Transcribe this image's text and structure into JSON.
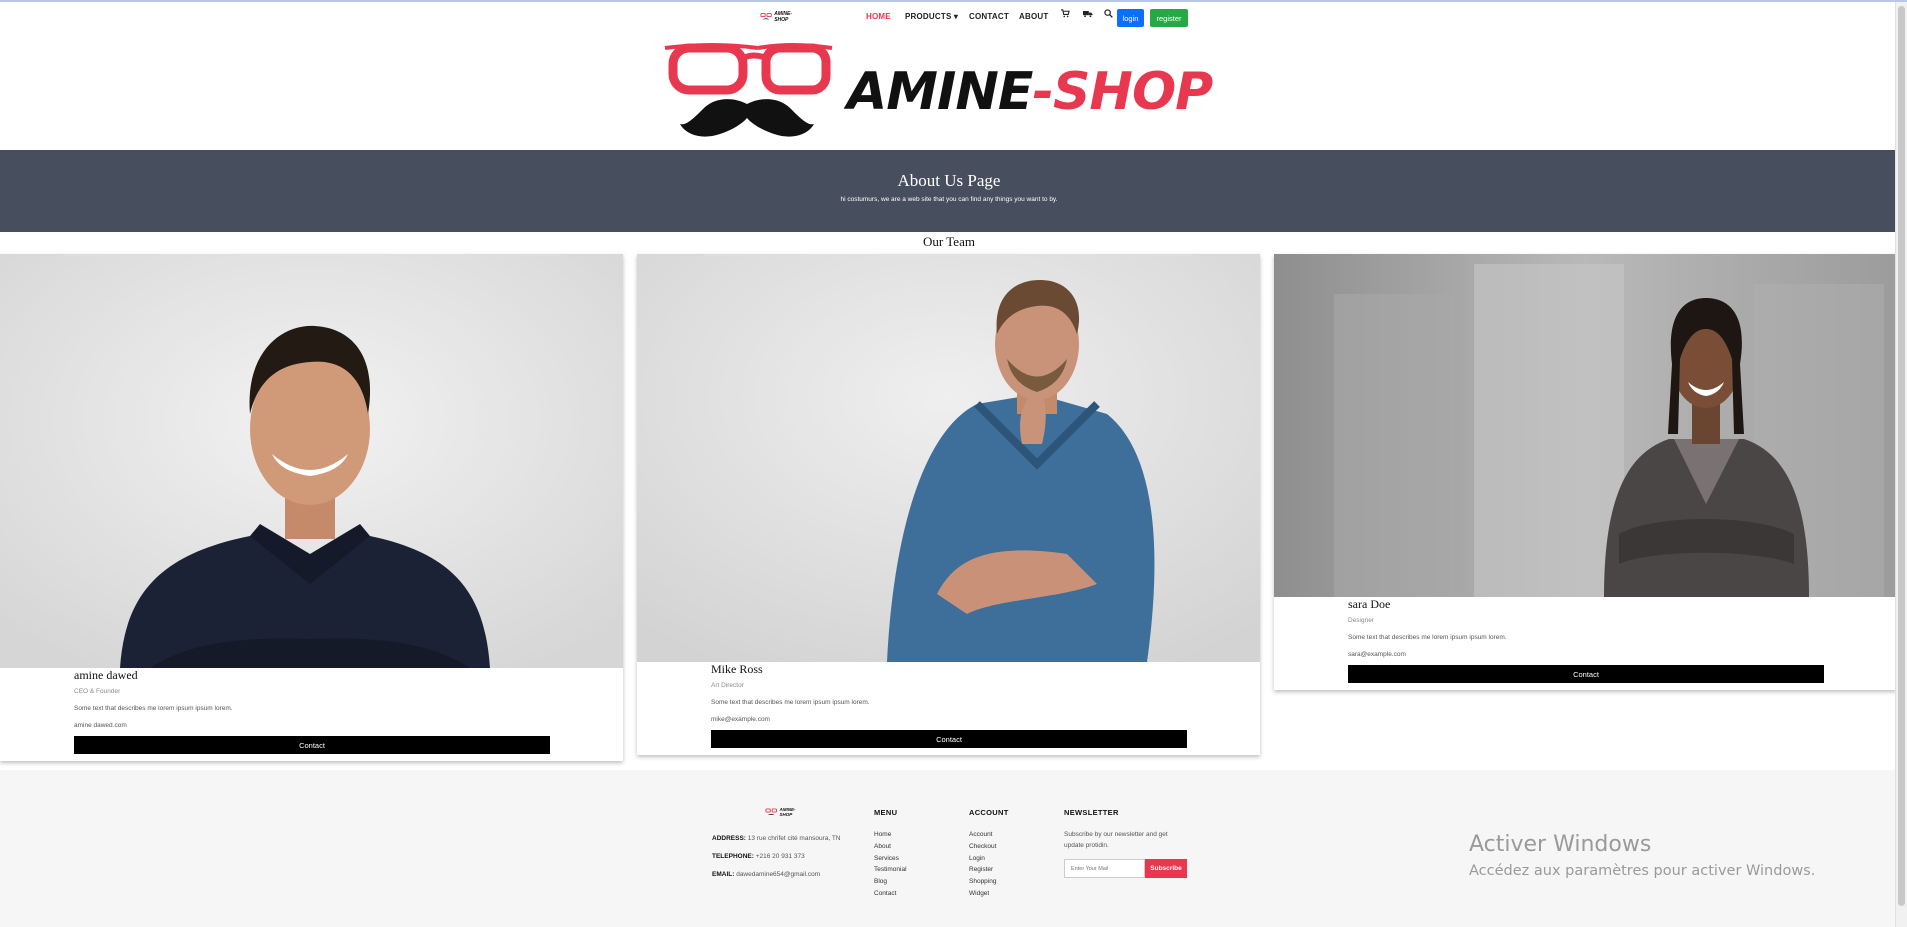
{
  "nav": {
    "logo_text": "AMINE-SHOP",
    "links": [
      {
        "label": "HOME"
      },
      {
        "label": "PRODUCTS ▾"
      },
      {
        "label": "CONTACT"
      },
      {
        "label": "ABOUT"
      }
    ],
    "icons": [
      "cart-icon",
      "delivery-truck-icon",
      "search-icon"
    ],
    "login_label": "login",
    "register_label": "register",
    "active_color": "#e8384f"
  },
  "hero": {
    "brand_part1": "AMINE",
    "brand_part2": "-SHOP",
    "brand_accent": "#e8384f"
  },
  "banner": {
    "title": "About Us Page",
    "subtitle": "hi costumurs, we are a web site that you can find any things you want to by."
  },
  "team": {
    "heading": "Our Team",
    "members": [
      {
        "name": "amine dawed",
        "role": "CEO & Founder",
        "description": "Some text that describes me lorem ipsum ipsum lorem.",
        "email": "amine dawed.com",
        "contact_label": "Contact"
      },
      {
        "name": "Mike Ross",
        "role": "Art Director",
        "description": "Some text that describes me lorem ipsum ipsum lorem.",
        "email": "mike@example.com",
        "contact_label": "Contact"
      },
      {
        "name": "sara Doe",
        "role": "Designer",
        "description": "Some text that describes me lorem ipsum ipsum lorem.",
        "email": "sara@example.com",
        "contact_label": "Contact"
      }
    ]
  },
  "footer": {
    "logo_text": "AMINE-SHOP",
    "address_label": "ADDRESS:",
    "address_value": "13 rue chrifet cité mansoura, TN",
    "telephone_label": "TELEPHONE:",
    "telephone_value": "+216 20 931 373",
    "email_label": "EMAIL:",
    "email_value": "dawedamine654@gmail.com",
    "menu": {
      "title": "MENU",
      "items": [
        "Home",
        "About",
        "Services",
        "Testimonial",
        "Blog",
        "Contact"
      ]
    },
    "account": {
      "title": "ACCOUNT",
      "items": [
        "Account",
        "Checkout",
        "Login",
        "Register",
        "Shopping",
        "Widget"
      ]
    },
    "newsletter": {
      "title": "NEWSLETTER",
      "text": "Subscribe by our newsletter and get update protidin.",
      "input_placeholder": "Enter Your Mail",
      "button_label": "Subscribe"
    }
  },
  "watermark": {
    "line1": "Activer Windows",
    "line2": "Accédez aux paramètres pour activer Windows."
  }
}
